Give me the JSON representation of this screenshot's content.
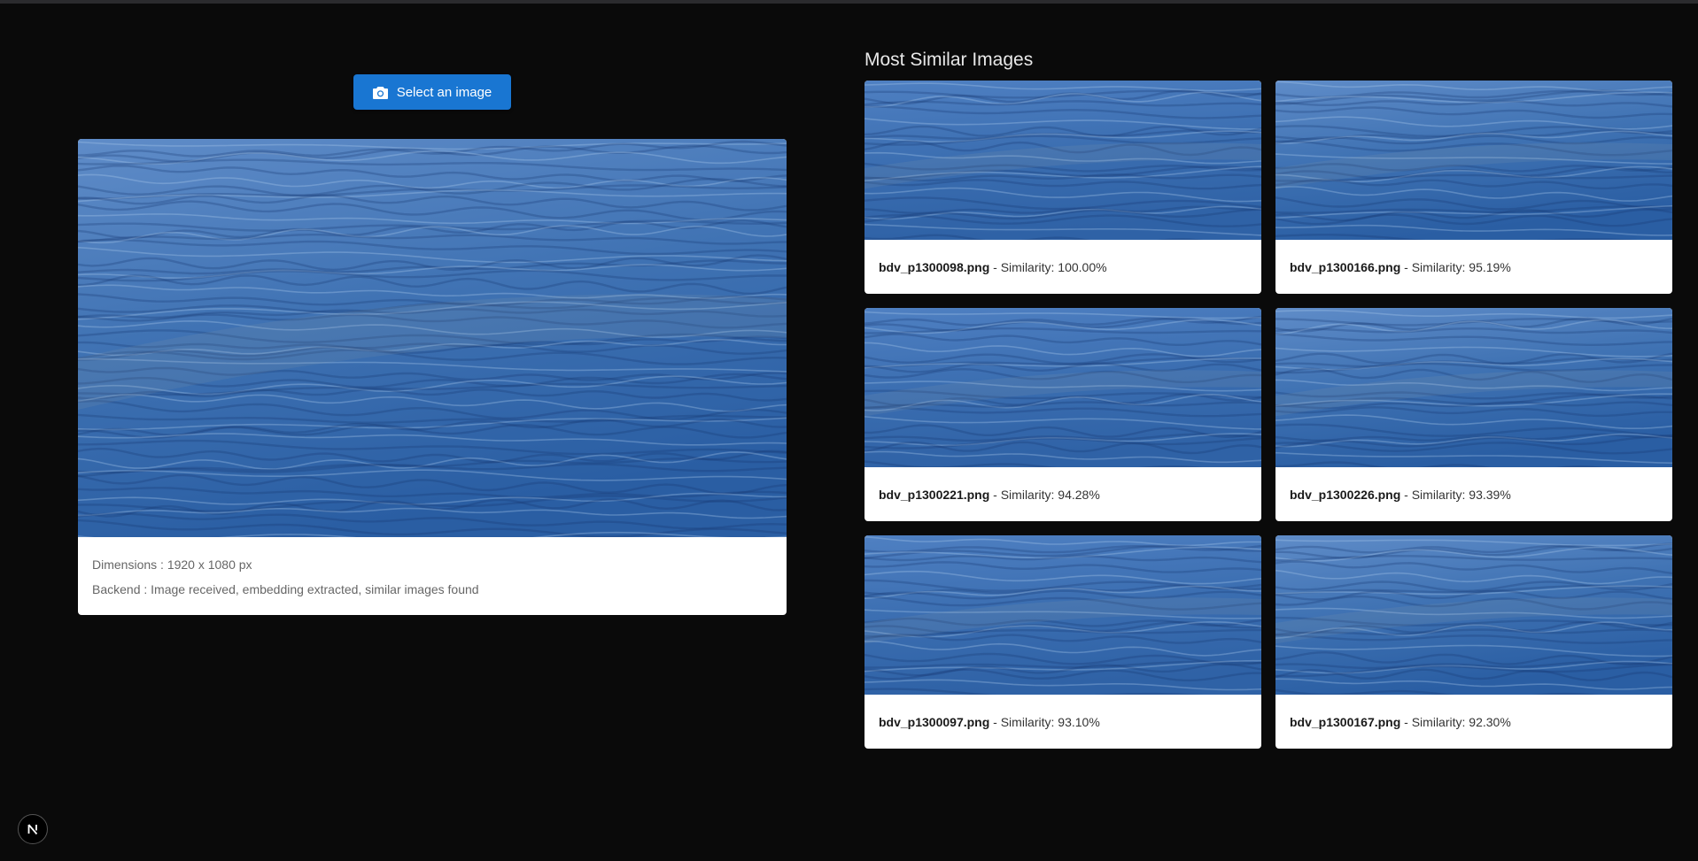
{
  "upload": {
    "button_label": "Select an image",
    "button_icon": "camera-icon",
    "button_color": "#1976d2"
  },
  "preview": {
    "dimensions_label": "Dimensions",
    "dimensions_value": "1920 x 1080 px",
    "backend_label": "Backend",
    "backend_status": "Image received, embedding extracted, similar images found"
  },
  "results": {
    "title": "Most Similar Images",
    "separator": "- Similarity:",
    "items": [
      {
        "filename": "bdv_p1300098.png",
        "similarity": "100.00%"
      },
      {
        "filename": "bdv_p1300166.png",
        "similarity": "95.19%"
      },
      {
        "filename": "bdv_p1300221.png",
        "similarity": "94.28%"
      },
      {
        "filename": "bdv_p1300226.png",
        "similarity": "93.39%"
      },
      {
        "filename": "bdv_p1300097.png",
        "similarity": "93.10%"
      },
      {
        "filename": "bdv_p1300167.png",
        "similarity": "92.30%"
      }
    ]
  },
  "devtools": {
    "badge_letter": "N",
    "badge_icon": "nextjs-logo-icon"
  },
  "colors": {
    "background": "#0a0a0a",
    "accent": "#1976d2",
    "water_light": "#5f8cc8",
    "water_dark": "#2a5ea3"
  }
}
